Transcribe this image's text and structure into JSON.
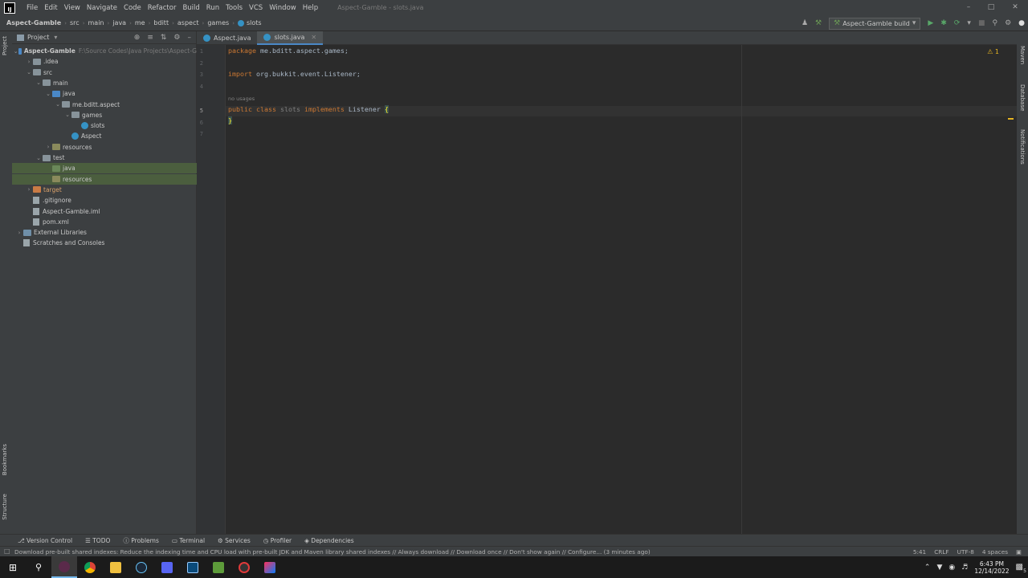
{
  "menu": [
    "File",
    "Edit",
    "View",
    "Navigate",
    "Code",
    "Refactor",
    "Build",
    "Run",
    "Tools",
    "VCS",
    "Window",
    "Help"
  ],
  "window_title": "Aspect-Gamble - slots.java",
  "breadcrumbs": [
    "Aspect-Gamble",
    "src",
    "main",
    "java",
    "me",
    "bditt",
    "aspect",
    "games",
    "slots"
  ],
  "run_config": "Aspect-Gamble build",
  "project_panel": {
    "title": "Project",
    "tree": [
      {
        "label": "Aspect-Gamble",
        "path": "F:\\Source Codes\\Java Projects\\Aspect-G",
        "indent": 0,
        "arrow": "open",
        "kind": "project"
      },
      {
        "label": ".idea",
        "indent": 1,
        "arrow": "closed",
        "kind": "folder"
      },
      {
        "label": "src",
        "indent": 1,
        "arrow": "open",
        "kind": "folder"
      },
      {
        "label": "main",
        "indent": 2,
        "arrow": "open",
        "kind": "folder"
      },
      {
        "label": "java",
        "indent": 3,
        "arrow": "open",
        "kind": "src"
      },
      {
        "label": "me.bditt.aspect",
        "indent": 4,
        "arrow": "open",
        "kind": "folder"
      },
      {
        "label": "games",
        "indent": 5,
        "arrow": "open",
        "kind": "folder"
      },
      {
        "label": "slots",
        "indent": 6,
        "arrow": "none",
        "kind": "class"
      },
      {
        "label": "Aspect",
        "indent": 5,
        "arrow": "none",
        "kind": "class"
      },
      {
        "label": "resources",
        "indent": 3,
        "arrow": "closed",
        "kind": "res"
      },
      {
        "label": "test",
        "indent": 2,
        "arrow": "open",
        "kind": "folder"
      },
      {
        "label": "java",
        "indent": 3,
        "arrow": "none",
        "kind": "test",
        "selected": true
      },
      {
        "label": "resources",
        "indent": 3,
        "arrow": "none",
        "kind": "res",
        "selected": true
      },
      {
        "label": "target",
        "indent": 1,
        "arrow": "closed",
        "kind": "target"
      },
      {
        "label": ".gitignore",
        "indent": 1,
        "arrow": "none",
        "kind": "file"
      },
      {
        "label": "Aspect-Gamble.iml",
        "indent": 1,
        "arrow": "none",
        "kind": "file"
      },
      {
        "label": "pom.xml",
        "indent": 1,
        "arrow": "none",
        "kind": "file"
      },
      {
        "label": "External Libraries",
        "indent": 0,
        "arrow": "closed",
        "kind": "lib"
      },
      {
        "label": "Scratches and Consoles",
        "indent": 0,
        "arrow": "none",
        "kind": "scratch"
      }
    ]
  },
  "tabs": [
    {
      "label": "Aspect.java",
      "active": false
    },
    {
      "label": "slots.java",
      "active": true
    }
  ],
  "editor": {
    "line_numbers": [
      "1",
      "2",
      "3",
      "4",
      "5",
      "6",
      "7"
    ],
    "line1_kw": "package",
    "line1_rest": " me.bditt.aspect.games;",
    "line3_kw": "import",
    "line3_rest": " org.bukkit.event.Listener;",
    "hint": "no usages",
    "line5_public": "public",
    "line5_class": " class",
    "line5_name": " slots",
    "line5_impl": " implements",
    "line5_iface": " Listener ",
    "line5_brace": "{",
    "line6_brace": "}",
    "warning_count": "1"
  },
  "left_strip": [
    "Project",
    "Bookmarks",
    "Structure"
  ],
  "right_strip": [
    "Maven",
    "Database",
    "Notifications"
  ],
  "bottom_tools": [
    "Version Control",
    "TODO",
    "Problems",
    "Terminal",
    "Services",
    "Profiler",
    "Dependencies"
  ],
  "status": {
    "message": "Download pre-built shared indexes: Reduce the indexing time and CPU load with pre-built JDK and Maven library shared indexes // Always download // Download once // Don't show again // Configure... (3 minutes ago)",
    "position": "5:41",
    "line_sep": "CRLF",
    "encoding": "UTF-8",
    "indent": "4 spaces"
  },
  "clock": {
    "time": "6:43 PM",
    "date": "12/14/2022"
  },
  "notification_count": "5"
}
